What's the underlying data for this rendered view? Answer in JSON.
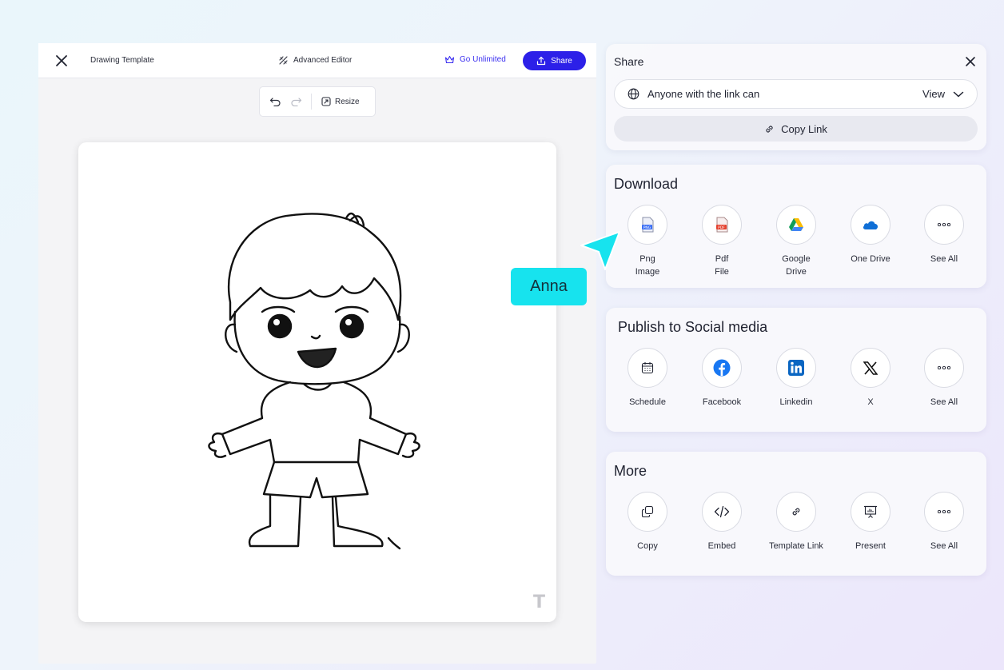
{
  "editor": {
    "doc_title": "Drawing Template",
    "advanced_editor": "Advanced Editor",
    "go_unlimited": "Go Unlimited",
    "share": "Share",
    "resize": "Resize"
  },
  "share_panel": {
    "title": "Share",
    "link_access": "Anyone with the link can",
    "permission": "View",
    "copy_link": "Copy Link"
  },
  "download": {
    "title": "Download",
    "items": [
      {
        "label": "Png\nImage",
        "icon": "png-file-icon"
      },
      {
        "label": "Pdf\nFile",
        "icon": "pdf-file-icon"
      },
      {
        "label": "Google\nDrive",
        "icon": "google-drive-icon"
      },
      {
        "label": "One Drive",
        "icon": "one-drive-icon"
      },
      {
        "label": "See All",
        "icon": "more-icon"
      }
    ]
  },
  "social": {
    "title": "Publish to Social media",
    "items": [
      {
        "label": "Schedule",
        "icon": "calendar-icon"
      },
      {
        "label": "Facebook",
        "icon": "facebook-icon"
      },
      {
        "label": "Linkedin",
        "icon": "linkedin-icon"
      },
      {
        "label": "X",
        "icon": "x-icon"
      },
      {
        "label": "See All",
        "icon": "more-icon"
      }
    ]
  },
  "more": {
    "title": "More",
    "items": [
      {
        "label": "Copy",
        "icon": "copy-icon"
      },
      {
        "label": "Embed",
        "icon": "code-icon"
      },
      {
        "label": "Template Link",
        "icon": "link-icon"
      },
      {
        "label": "Present",
        "icon": "presentation-icon"
      },
      {
        "label": "See All",
        "icon": "more-icon"
      }
    ]
  },
  "collaborator": {
    "name": "Anna",
    "color": "#17e3ee"
  },
  "colors": {
    "accent": "#2c20e8",
    "go_unlimited": "#3a2ef0"
  }
}
